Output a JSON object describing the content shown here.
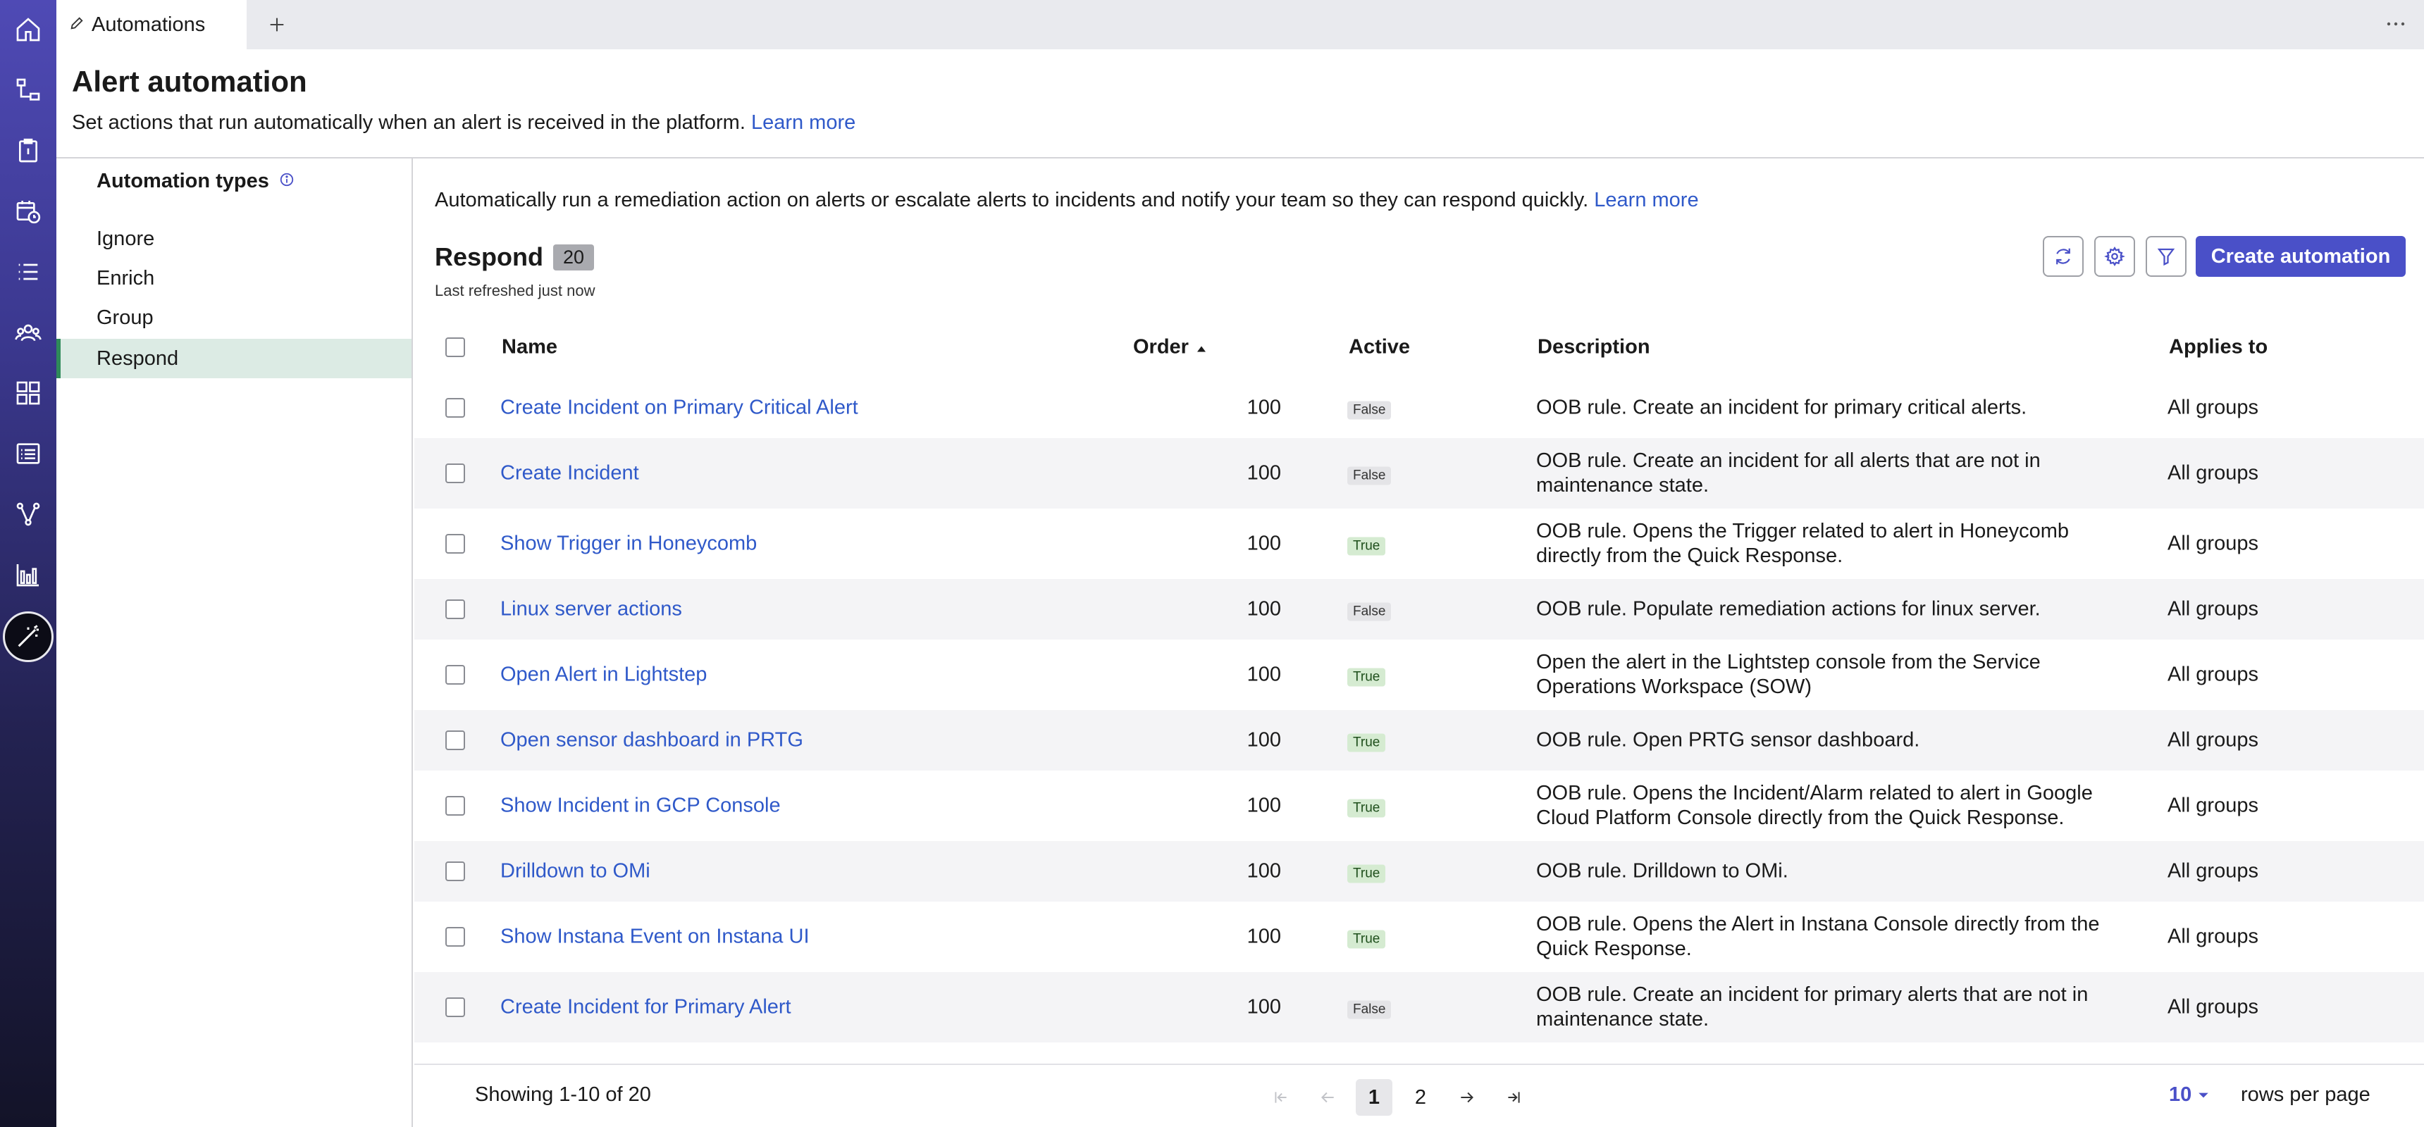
{
  "tabs": {
    "active_label": "Automations"
  },
  "header": {
    "title": "Alert automation",
    "subtitle": "Set actions that run automatically when an alert is received in the platform.",
    "learn_more": "Learn more"
  },
  "sidebar": {
    "title": "Automation types",
    "items": [
      "Ignore",
      "Enrich",
      "Group",
      "Respond"
    ],
    "selected": "Respond"
  },
  "main": {
    "intro": "Automatically run a remediation action on alerts or escalate alerts to incidents and notify your team so they can respond quickly.",
    "learn_more": "Learn more",
    "list_title": "Respond",
    "count": "20",
    "refreshed": "Last refreshed just now",
    "create_label": "Create automation"
  },
  "table": {
    "columns": {
      "name": "Name",
      "order": "Order",
      "active": "Active",
      "description": "Description",
      "applies": "Applies to"
    },
    "rows": [
      {
        "name": "Create Incident on Primary Critical Alert",
        "order": "100",
        "active": "False",
        "description": "OOB rule. Create an incident for primary critical alerts.",
        "applies": "All groups"
      },
      {
        "name": "Create Incident",
        "order": "100",
        "active": "False",
        "description": "OOB rule. Create an incident for all alerts that are not in maintenance state.",
        "applies": "All groups"
      },
      {
        "name": "Show Trigger in Honeycomb",
        "order": "100",
        "active": "True",
        "description": "OOB rule. Opens the Trigger related to alert in Honeycomb directly from the Quick Response.",
        "applies": "All groups"
      },
      {
        "name": "Linux server actions",
        "order": "100",
        "active": "False",
        "description": "OOB rule. Populate remediation actions for linux server.",
        "applies": "All groups"
      },
      {
        "name": "Open Alert in Lightstep",
        "order": "100",
        "active": "True",
        "description": "Open the alert in the Lightstep console from the Service Operations Workspace (SOW)",
        "applies": "All groups"
      },
      {
        "name": "Open sensor dashboard in PRTG",
        "order": "100",
        "active": "True",
        "description": "OOB rule. Open PRTG sensor dashboard.",
        "applies": "All groups"
      },
      {
        "name": "Show Incident in GCP Console",
        "order": "100",
        "active": "True",
        "description": "OOB rule. Opens the Incident/Alarm related to alert in Google Cloud Platform Console directly from the Quick Response.",
        "applies": "All groups"
      },
      {
        "name": "Drilldown to OMi",
        "order": "100",
        "active": "True",
        "description": "OOB rule. Drilldown to OMi.",
        "applies": "All groups"
      },
      {
        "name": "Show Instana Event on Instana UI",
        "order": "100",
        "active": "True",
        "description": "OOB rule. Opens the Alert in Instana Console directly from the Quick Response.",
        "applies": "All groups"
      },
      {
        "name": "Create Incident for Primary Alert",
        "order": "100",
        "active": "False",
        "description": "OOB rule. Create an incident for primary alerts that are not in maintenance state.",
        "applies": "All groups"
      }
    ]
  },
  "pagination": {
    "showing": "Showing 1-10 of 20",
    "pages": [
      "1",
      "2"
    ],
    "current": "1",
    "rows_per_page": "10",
    "rows_label": "rows per page"
  },
  "icons": {
    "rail": [
      "home-icon",
      "workflow-icon",
      "clipboard-icon",
      "calendar-clock-icon",
      "list-icon",
      "team-icon",
      "grid-icon",
      "table-list-icon",
      "branch-icon",
      "bar-chart-icon",
      "magic-wand-icon"
    ],
    "tab": "pencil-icon",
    "toolbar": [
      "refresh-icon",
      "gear-icon",
      "filter-icon"
    ]
  },
  "colors": {
    "accent": "#4a50c8",
    "link": "#2f59c9",
    "selected_bg": "#dcebe4",
    "selected_border": "#2f8a5a",
    "true_pill": "#d5ebd1",
    "false_pill": "#e4e4e7"
  }
}
